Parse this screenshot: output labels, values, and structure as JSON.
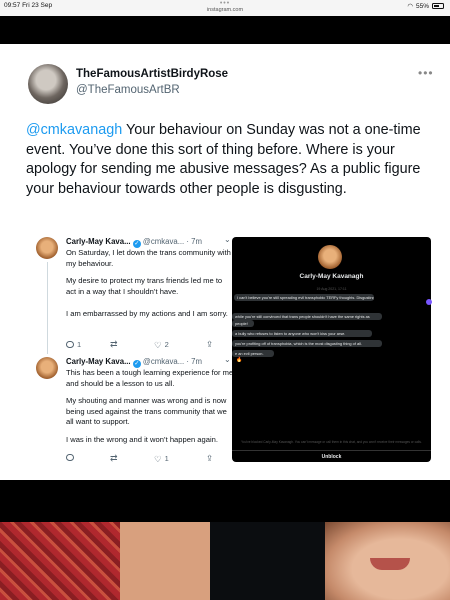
{
  "status_bar": {
    "time": "09:57  Fri 23 Sep",
    "url": "instagram.com",
    "dots": "•••",
    "battery": "55%"
  },
  "tweet": {
    "display_name": "TheFamousArtistBirdyRose",
    "handle": "@TheFamousArtBR",
    "more": "•••",
    "mention": "@cmkavanagh",
    "text": " Your behaviour on Sunday was not a one-time event. You’ve done this sort of thing before. Where is your apology for sending me abusive messages? As a public figure your behaviour towards other people is disgusting."
  },
  "screenshot": {
    "tweets": [
      {
        "name": "Carly-May Kava...",
        "meta": " @cmkava... · 7m",
        "paragraphs": [
          "On Saturday, I let down the trans community with my behaviour.",
          "My desire to protect my trans friends led me to act in a way that I shouldn’t have.",
          "I am embarrassed by my actions and I am sorry."
        ],
        "reply_count": "1",
        "like_count": "2"
      },
      {
        "name": "Carly-May Kava...",
        "meta": " @cmkava... · 7m",
        "paragraphs": [
          "This has been a tough learning experience for me and should be a lesson to us all.",
          "My shouting and manner was wrong and is now being used against the trans community that we all want to support.",
          "I was in the wrong and it won’t happen again."
        ],
        "reply_count": "",
        "like_count": "1"
      }
    ],
    "dm": {
      "name": "Carly-May Kavanagh",
      "date": "19 Aug 2021, 17:11",
      "messages": [
        "I can't believe you're still spreading evil transphobic TERFy thoughts. Disgusting.",
        "while you're still convinced that trans people shouldn't have the same rights as",
        "people!",
        "a bully who refuses to listen to anyone who won't kiss your arse.",
        "you're profiting off of transphobia, which is the most disgusting thing of all.",
        "e an evil person.",
        "🔥"
      ],
      "footer": "You've blocked Carly-May Kavanagh. You can't message or call them in this chat, and you won't receive their messages or calls.",
      "unblock": "Unblock"
    }
  }
}
